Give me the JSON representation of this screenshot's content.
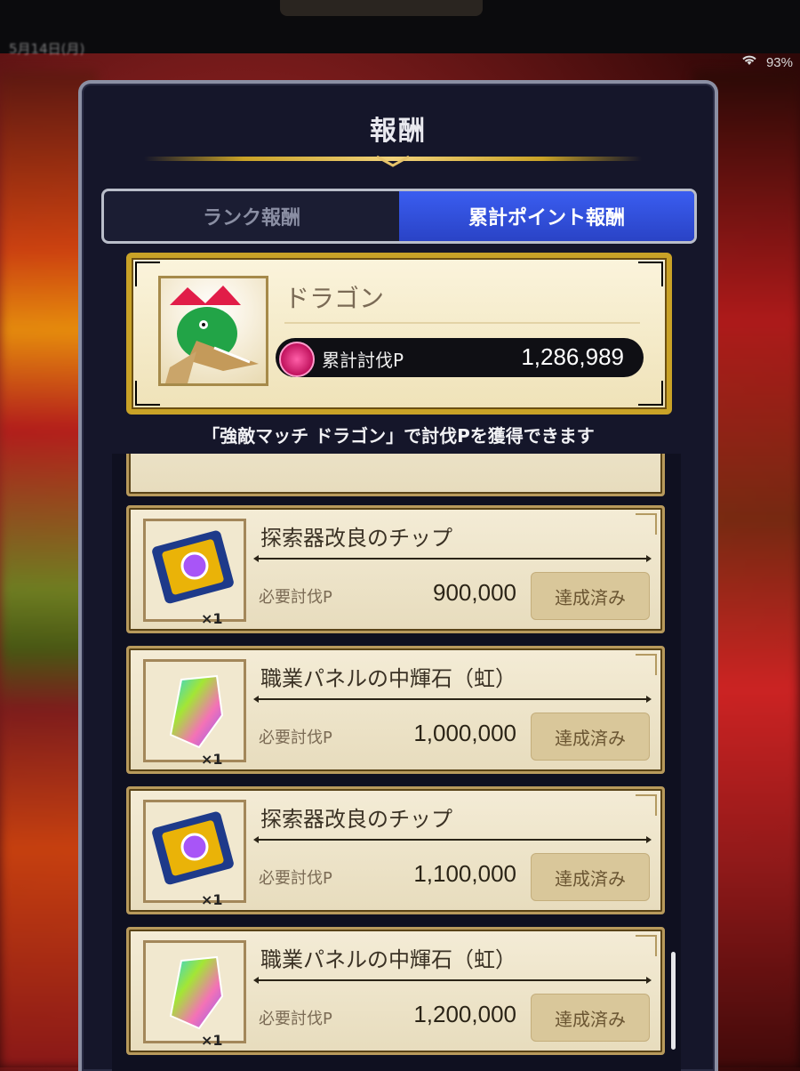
{
  "status_bar": {
    "time": "5月14日(月)",
    "wifi_icon": "wifi-icon",
    "battery": "93%"
  },
  "dialog": {
    "title": "報酬",
    "tabs": [
      {
        "label": "ランク報酬",
        "active": false
      },
      {
        "label": "累計ポイント報酬",
        "active": true
      }
    ]
  },
  "boss": {
    "name": "ドラゴン",
    "points_label": "累計討伐P",
    "points_value": "1,286,989"
  },
  "hint": "「強敵マッチ ドラゴン」で討伐Pを獲得できます",
  "rewards": [
    {
      "name": "探索器改良のチップ",
      "icon": "chip-icon",
      "qty": "×1",
      "req_label": "必要討伐P",
      "req_value": "900,000",
      "status": "達成済み"
    },
    {
      "name": "職業パネルの中輝石（虹）",
      "icon": "rainbow-stone-icon",
      "qty": "×1",
      "req_label": "必要討伐P",
      "req_value": "1,000,000",
      "status": "達成済み"
    },
    {
      "name": "探索器改良のチップ",
      "icon": "chip-icon",
      "qty": "×1",
      "req_label": "必要討伐P",
      "req_value": "1,100,000",
      "status": "達成済み"
    },
    {
      "name": "職業パネルの中輝石（虹）",
      "icon": "rainbow-stone-icon",
      "qty": "×1",
      "req_label": "必要討伐P",
      "req_value": "1,200,000",
      "status": "達成済み"
    }
  ]
}
